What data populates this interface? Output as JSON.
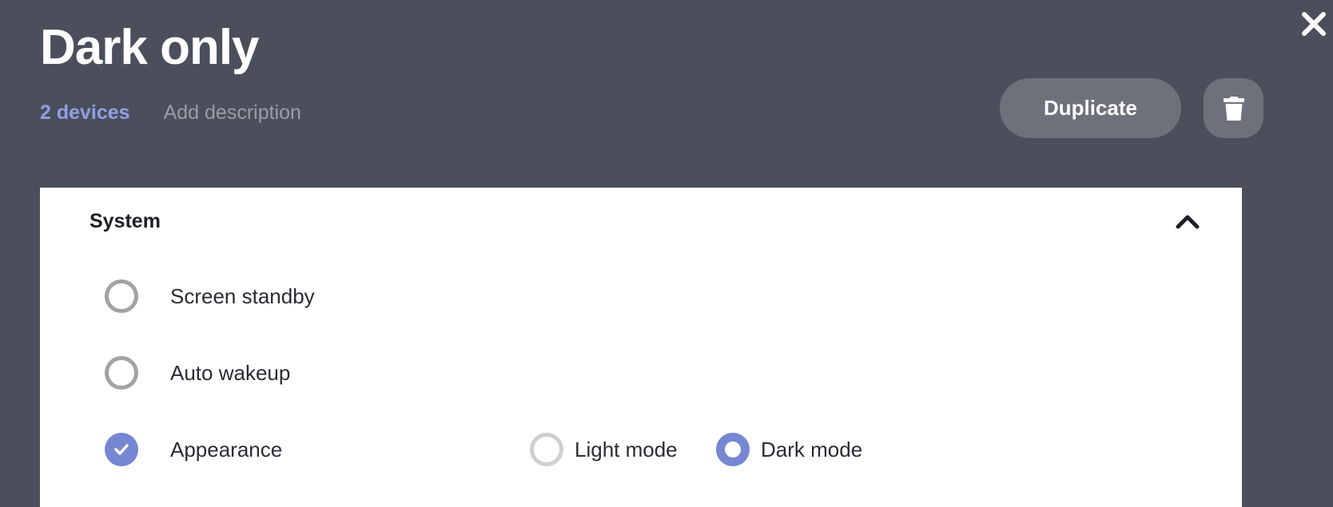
{
  "header": {
    "title": "Dark only",
    "device_count": "2 devices",
    "add_description": "Add description",
    "duplicate_label": "Duplicate"
  },
  "icons": {
    "close": "close-icon",
    "delete": "trash-icon",
    "collapse": "chevron-up-icon",
    "checked": "checkmark-icon"
  },
  "section": {
    "title": "System",
    "options": [
      {
        "label": "Screen standby",
        "checked": false
      },
      {
        "label": "Auto wakeup",
        "checked": false
      },
      {
        "label": "Appearance",
        "checked": true
      }
    ],
    "appearance_modes": [
      {
        "label": "Light mode",
        "selected": false
      },
      {
        "label": "Dark mode",
        "selected": true
      }
    ]
  },
  "colors": {
    "background": "#4b4f5c",
    "accent": "#7686d3",
    "link": "#8fa0e3",
    "button": "#6e717c"
  }
}
